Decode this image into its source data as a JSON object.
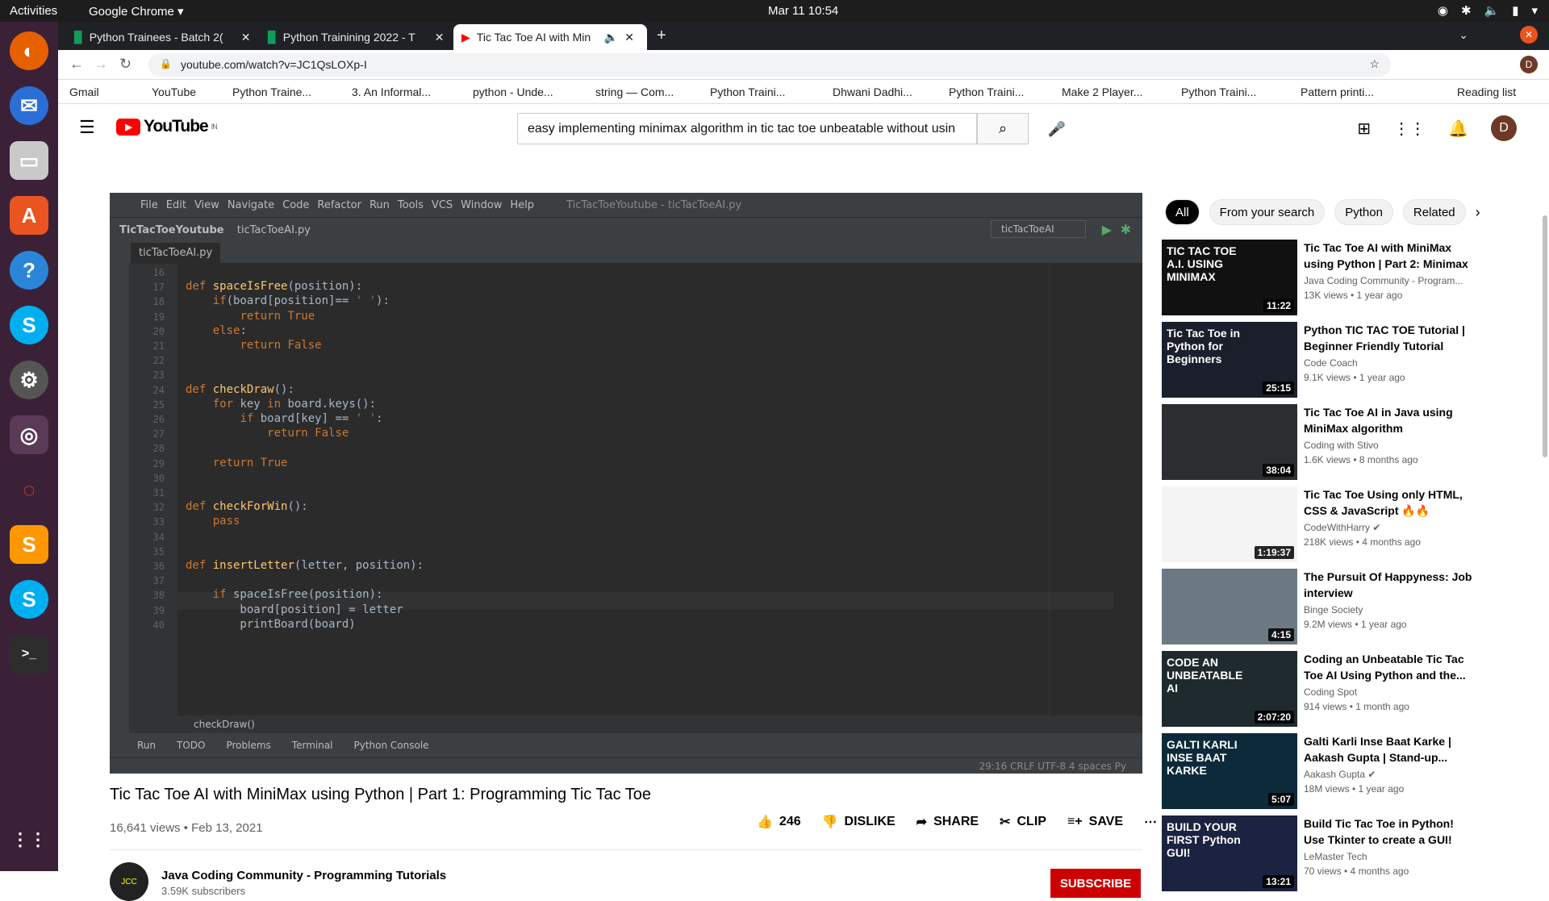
{
  "system": {
    "activities": "Activities",
    "app": "Google Chrome ▾",
    "clock": "Mar 11  10:54"
  },
  "tabs": [
    {
      "title": "Python Trainees - Batch 2(",
      "icon_color": "#0f9d58"
    },
    {
      "title": "Python Trainining 2022 - T",
      "icon_color": "#0f9d58"
    },
    {
      "title": "Tic Tac Toe AI with Min",
      "icon_color": "#ff0000"
    }
  ],
  "url": "youtube.com/watch?v=JC1QsLOXp-I",
  "bookmarks": [
    "Gmail",
    "YouTube",
    "Python Traine...",
    "3. An Informal...",
    "python - Unde...",
    "string — Com...",
    "Python Traini...",
    "Dhwani Dadhi...",
    "Python Traini...",
    "Make 2 Player...",
    "Python Traini...",
    "Pattern printi..."
  ],
  "reading_list": "Reading list",
  "youtube": {
    "logo_text": "YouTube",
    "region": "IN",
    "search_value": "easy implementing minimax algorithm in tic tac toe unbeatable without usin",
    "avatar_letter": "D"
  },
  "ide": {
    "menu": [
      "File",
      "Edit",
      "View",
      "Navigate",
      "Code",
      "Refactor",
      "Run",
      "Tools",
      "VCS",
      "Window",
      "Help"
    ],
    "project_title": "TicTacToeYoutube - ticTacToeAI.py",
    "breadcrumb_project": "TicTacToeYoutube",
    "breadcrumb_file": "ticTacToeAI.py",
    "run_config": "ticTacToeAI",
    "tab": "ticTacToeAI.py",
    "line_numbers": [
      "16",
      "17",
      "18",
      "19",
      "20",
      "21",
      "22",
      "23",
      "24",
      "25",
      "26",
      "27",
      "28",
      "29",
      "30",
      "31",
      "32",
      "33",
      "34",
      "35",
      "36",
      "37",
      "38",
      "39",
      "40"
    ],
    "code_lines": [
      "",
      "def spaceIsFree(position):",
      "    if(board[position]== ' '):",
      "        return True",
      "    else:",
      "        return False",
      "",
      "",
      "def checkDraw():",
      "    for key in board.keys():",
      "        if board[key] == ' ':",
      "            return False",
      "",
      "    return True",
      "",
      "",
      "def checkForWin():",
      "    pass",
      "",
      "",
      "def insertLetter(letter, position):",
      "",
      "    if spaceIsFree(position):",
      "        board[position] = letter",
      "        printBoard(board)"
    ],
    "crumb_fn": "checkDraw()",
    "bottom_tabs": [
      "Run",
      "TODO",
      "Problems",
      "Terminal",
      "Python Console"
    ],
    "status": "29:16   CRLF   UTF-8   4 spaces   Py"
  },
  "video": {
    "title": "Tic Tac Toe AI with MiniMax using Python | Part 1: Programming Tic Tac Toe",
    "meta": "16,641 views • Feb 13, 2021",
    "likes": "246",
    "dislike": "DISLIKE",
    "share": "SHARE",
    "clip": "CLIP",
    "save": "SAVE",
    "channel": "Java Coding Community - Programming Tutorials",
    "subs": "3.59K subscribers",
    "subscribe": "SUBSCRIBE"
  },
  "chips": [
    "All",
    "From your search",
    "Python",
    "Related"
  ],
  "recommendations": [
    {
      "title": "Tic Tac Toe AI with MiniMax using Python | Part 2: Minimax",
      "channel": "Java Coding Community - Program...",
      "stats": "13K views • 1 year ago",
      "duration": "11:22",
      "thumb_color": "#111",
      "thumb_text": "TIC TAC TOE A.I. USING MINIMAX"
    },
    {
      "title": "Python TIC TAC TOE Tutorial | Beginner Friendly Tutorial",
      "channel": "Code Coach",
      "stats": "9.1K views • 1 year ago",
      "duration": "25:15",
      "thumb_color": "#1a1f2b",
      "thumb_text": "Tic Tac Toe in Python for Beginners"
    },
    {
      "title": "Tic Tac Toe AI in Java using MiniMax algorithm",
      "channel": "Coding with Stivo",
      "stats": "1.6K views • 8 months ago",
      "duration": "38:04",
      "thumb_color": "#2b2d30",
      "thumb_text": ""
    },
    {
      "title": "Tic Tac Toe Using only HTML, CSS & JavaScript 🔥🔥",
      "channel": "CodeWithHarry ✔",
      "stats": "218K views • 4 months ago",
      "duration": "1:19:37",
      "thumb_color": "#f4f4f4",
      "thumb_text": ""
    },
    {
      "title": "The Pursuit Of Happyness: Job interview",
      "channel": "Binge Society",
      "stats": "9.2M views • 1 year ago",
      "duration": "4:15",
      "thumb_color": "#6b7a82",
      "thumb_text": ""
    },
    {
      "title": "Coding an Unbeatable Tic Tac Toe AI Using Python and the...",
      "channel": "Coding Spot",
      "stats": "914 views • 1 month ago",
      "duration": "2:07:20",
      "thumb_color": "#1f2a2e",
      "thumb_text": "CODE AN UNBEATABLE AI"
    },
    {
      "title": "Galti Karli Inse Baat Karke | Aakash Gupta | Stand-up...",
      "channel": "Aakash Gupta ✔",
      "stats": "18M views • 1 year ago",
      "duration": "5:07",
      "thumb_color": "#0d2a3a",
      "thumb_text": "GALTI KARLI INSE BAAT KARKE"
    },
    {
      "title": "Build Tic Tac Toe in Python! Use Tkinter to create a GUI! Grids,...",
      "channel": "LeMaster Tech",
      "stats": "70 views • 4 months ago",
      "duration": "13:21",
      "thumb_color": "#1c2340",
      "thumb_text": "BUILD YOUR FIRST Python GUI!"
    }
  ]
}
